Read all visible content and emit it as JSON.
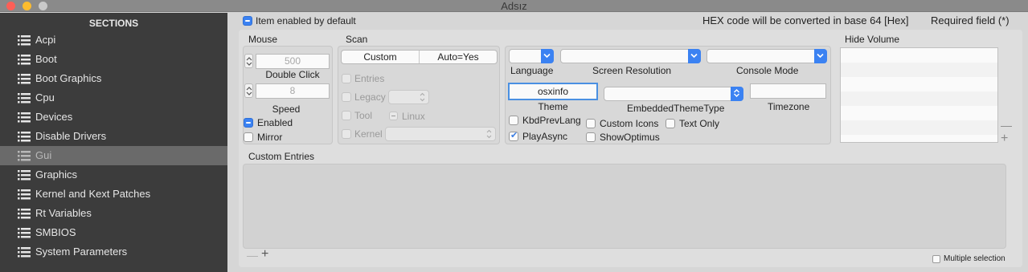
{
  "window": {
    "title": "Adsız"
  },
  "sidebar": {
    "header": "SECTIONS",
    "items": [
      {
        "label": "Acpi"
      },
      {
        "label": "Boot"
      },
      {
        "label": "Boot Graphics"
      },
      {
        "label": "Cpu"
      },
      {
        "label": "Devices"
      },
      {
        "label": "Disable Drivers"
      },
      {
        "label": "Gui",
        "selected": true
      },
      {
        "label": "Graphics"
      },
      {
        "label": "Kernel and Kext Patches"
      },
      {
        "label": "Rt Variables"
      },
      {
        "label": "SMBIOS"
      },
      {
        "label": "System Parameters"
      }
    ]
  },
  "header": {
    "item_enabled_label": "Item enabled by default",
    "hex_note": "HEX code will be converted in base 64 [Hex]",
    "required_note": "Required field (*)"
  },
  "mouse": {
    "title": "Mouse",
    "double_click_value": "500",
    "double_click_label": "Double Click",
    "speed_value": "8",
    "speed_label": "Speed",
    "enabled_label": "Enabled",
    "mirror_label": "Mirror"
  },
  "scan": {
    "title": "Scan",
    "segments": [
      "Custom",
      "Auto=Yes"
    ],
    "entries_label": "Entries",
    "legacy_label": "Legacy",
    "tool_label": "Tool",
    "linux_label": "Linux",
    "kernel_label": "Kernel"
  },
  "gui": {
    "language_label": "Language",
    "screen_resolution_label": "Screen Resolution",
    "console_mode_label": "Console Mode",
    "theme_value": "osxinfo",
    "theme_label": "Theme",
    "embedded_theme_type_label": "EmbeddedThemeType",
    "timezone_label": "Timezone",
    "kbd_prev_lang_label": "KbdPrevLang",
    "custom_icons_label": "Custom Icons",
    "text_only_label": "Text Only",
    "play_async_label": "PlayAsync",
    "show_optimus_label": "ShowOptimus"
  },
  "hide_volume": {
    "title": "Hide Volume"
  },
  "custom_entries": {
    "title": "Custom Entries",
    "multiple_selection_label": "Multiple selection"
  },
  "colors": {
    "sidebar_bg": "#3c3c3c",
    "selected_row": "#6a6a6a",
    "accent": "#3b82f2"
  }
}
